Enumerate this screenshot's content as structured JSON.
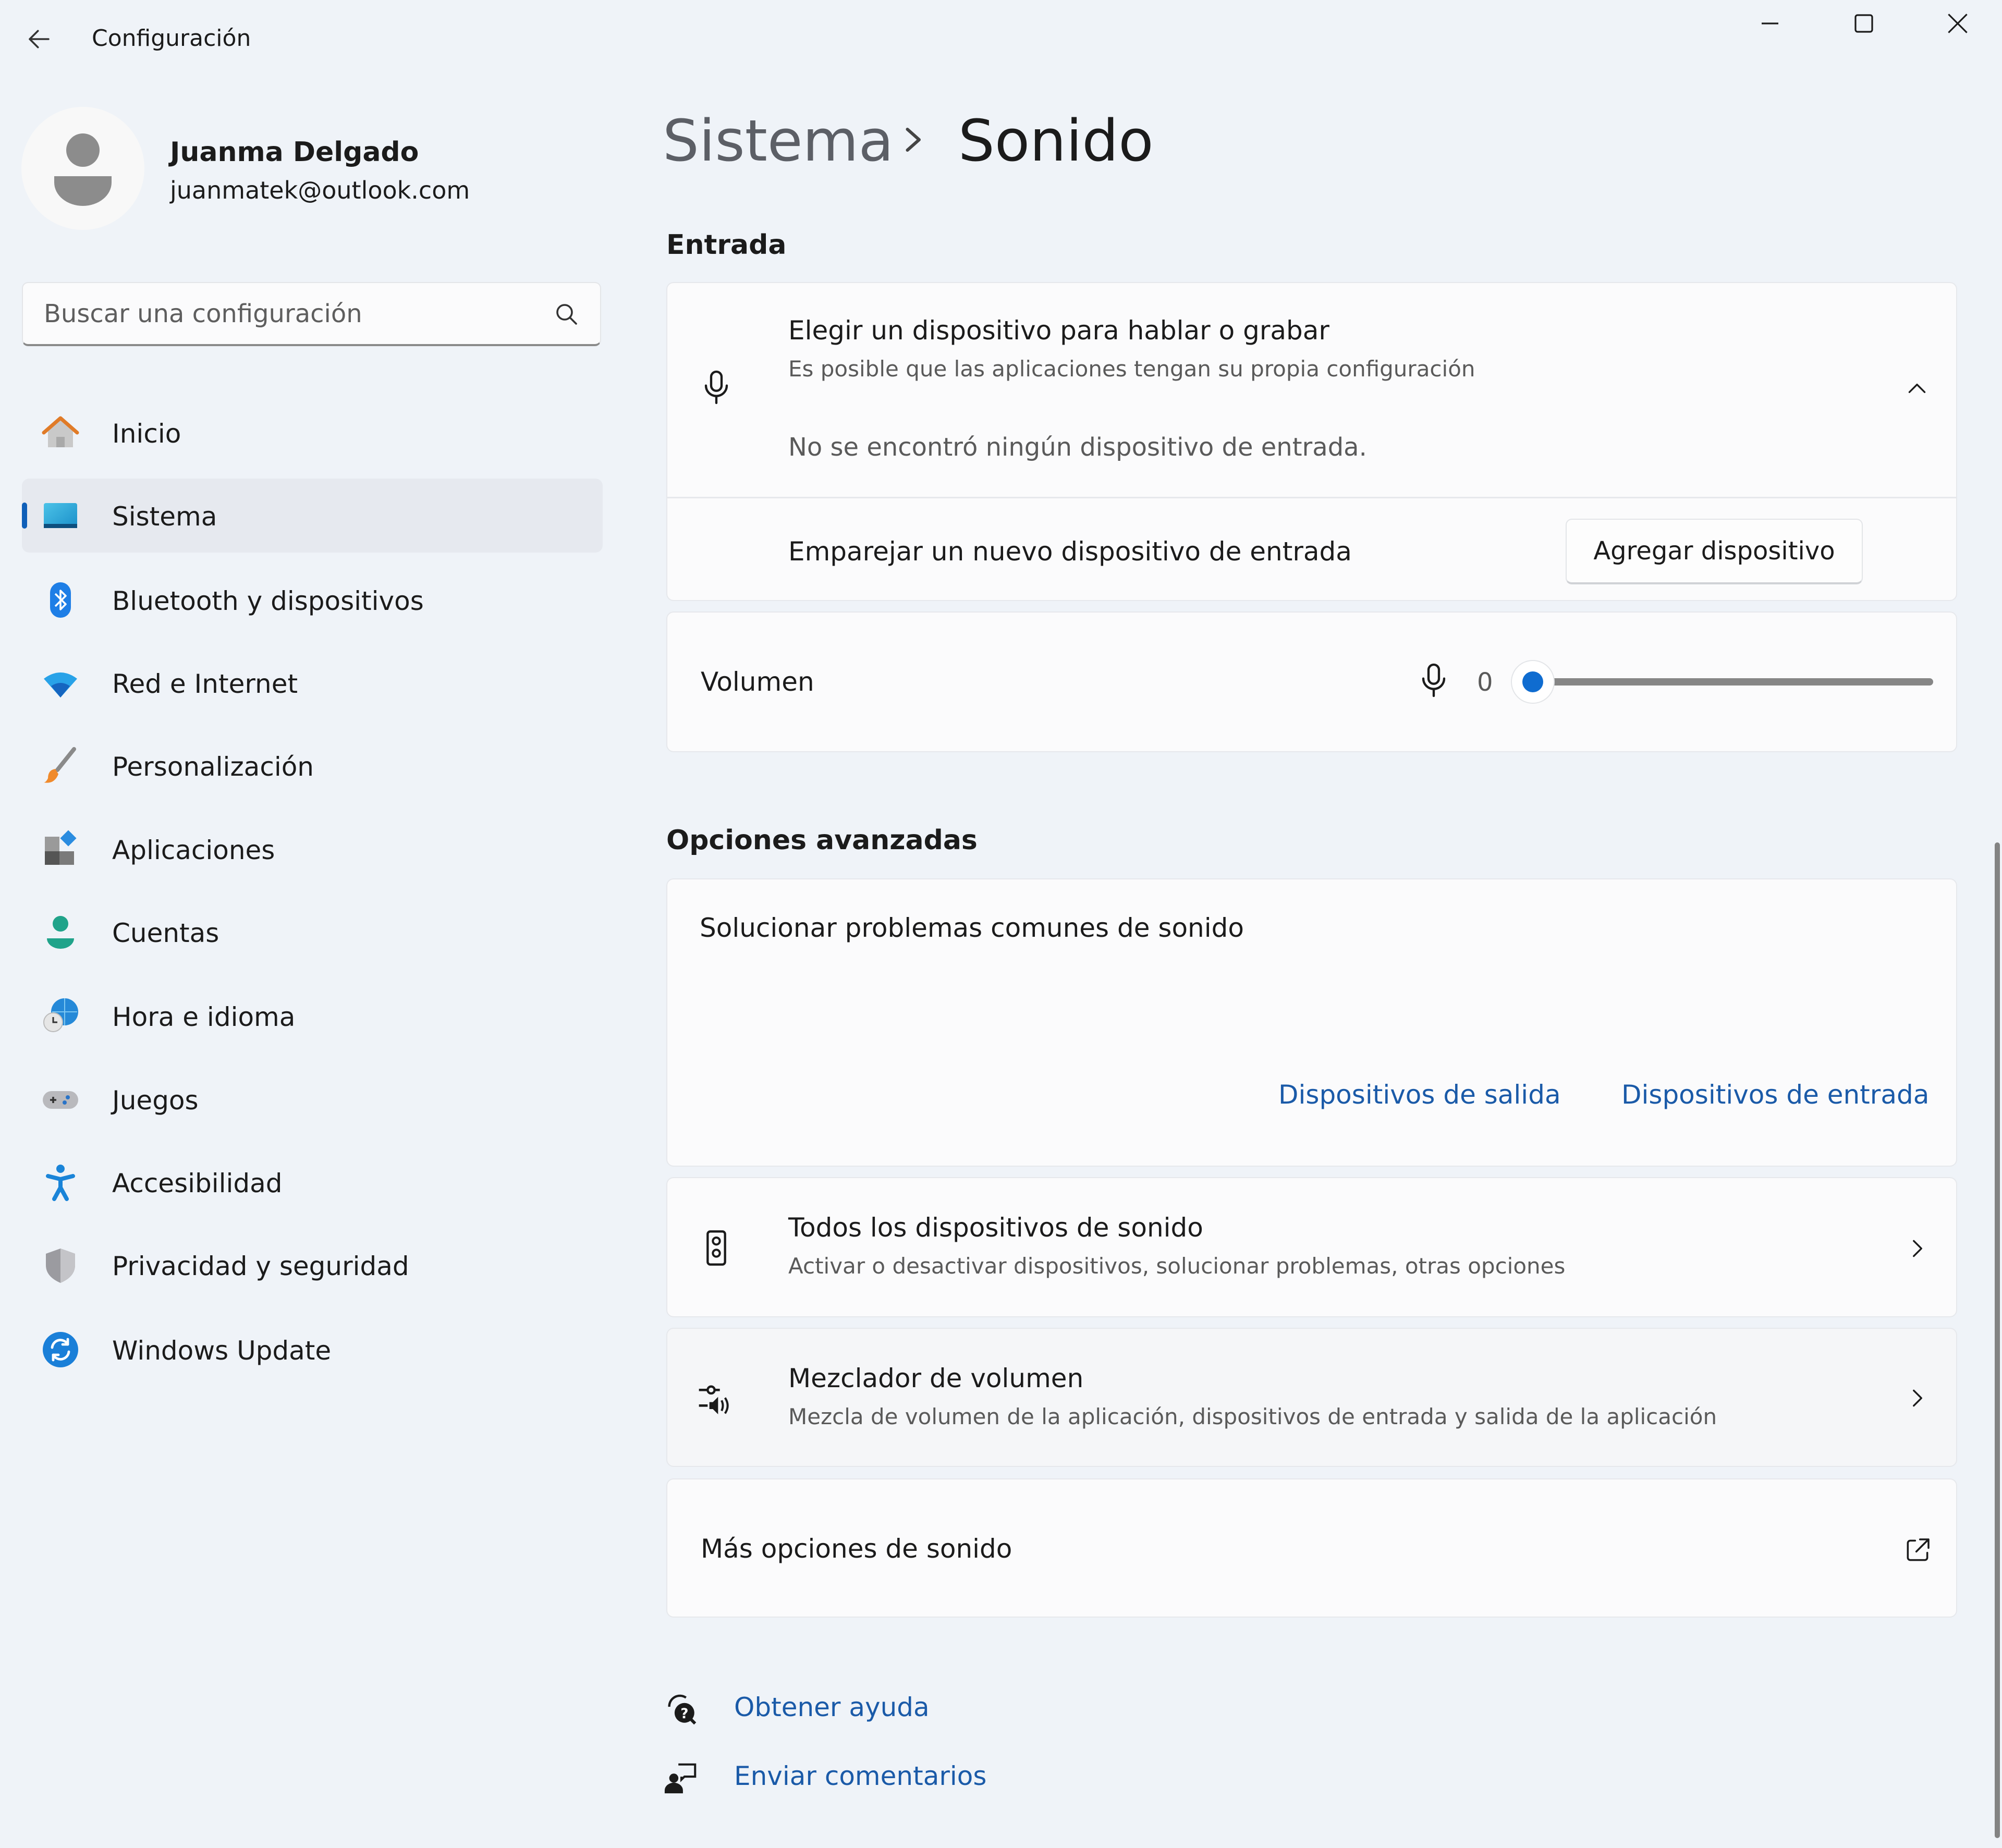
{
  "window": {
    "title": "Configuración",
    "controls": {
      "minimize": "minimize-icon",
      "maximize": "maximize-icon",
      "close": "close-icon"
    }
  },
  "profile": {
    "name": "Juanma Delgado",
    "email": "juanmatek@outlook.com"
  },
  "search": {
    "placeholder": "Buscar una configuración",
    "value": ""
  },
  "sidebar": {
    "items": [
      {
        "label": "Inicio",
        "icon": "home-icon",
        "selected": false
      },
      {
        "label": "Sistema",
        "icon": "system-icon",
        "selected": true
      },
      {
        "label": "Bluetooth y dispositivos",
        "icon": "bluetooth-icon",
        "selected": false
      },
      {
        "label": "Red e Internet",
        "icon": "wifi-icon",
        "selected": false
      },
      {
        "label": "Personalización",
        "icon": "paintbrush-icon",
        "selected": false
      },
      {
        "label": "Aplicaciones",
        "icon": "apps-icon",
        "selected": false
      },
      {
        "label": "Cuentas",
        "icon": "account-icon",
        "selected": false
      },
      {
        "label": "Hora e idioma",
        "icon": "time-language-icon",
        "selected": false
      },
      {
        "label": "Juegos",
        "icon": "gamepad-icon",
        "selected": false
      },
      {
        "label": "Accesibilidad",
        "icon": "accessibility-icon",
        "selected": false
      },
      {
        "label": "Privacidad y seguridad",
        "icon": "shield-icon",
        "selected": false
      },
      {
        "label": "Windows Update",
        "icon": "update-icon",
        "selected": false
      }
    ]
  },
  "breadcrumb": {
    "parent": "Sistema",
    "current": "Sonido"
  },
  "input_section": {
    "heading": "Entrada",
    "device_chooser": {
      "title": "Elegir un dispositivo para hablar o grabar",
      "subtitle": "Es posible que las aplicaciones tengan su propia configuración",
      "empty_message": "No se encontró ningún dispositivo de entrada.",
      "expanded": true
    },
    "pair": {
      "label": "Emparejar un nuevo dispositivo de entrada",
      "button": "Agregar dispositivo"
    },
    "volume": {
      "label": "Volumen",
      "value": "0",
      "level": 0
    }
  },
  "advanced": {
    "heading": "Opciones avanzadas",
    "troubleshoot": {
      "title": "Solucionar problemas comunes de sonido",
      "link_output": "Dispositivos de salida",
      "link_input": "Dispositivos de entrada"
    },
    "all_devices": {
      "title": "Todos los dispositivos de sonido",
      "subtitle": "Activar o desactivar dispositivos, solucionar problemas, otras opciones"
    },
    "mixer": {
      "title": "Mezclador de volumen",
      "subtitle": "Mezcla de volumen de la aplicación, dispositivos de entrada y salida de la aplicación"
    },
    "more": {
      "title": "Más opciones de sonido"
    }
  },
  "footer": {
    "help": "Obtener ayuda",
    "feedback": "Enviar comentarios"
  },
  "colors": {
    "accent": "#0f6cd0",
    "link": "#1a5aa8",
    "background": "#eff3f8",
    "card": "#fbfbfc"
  }
}
